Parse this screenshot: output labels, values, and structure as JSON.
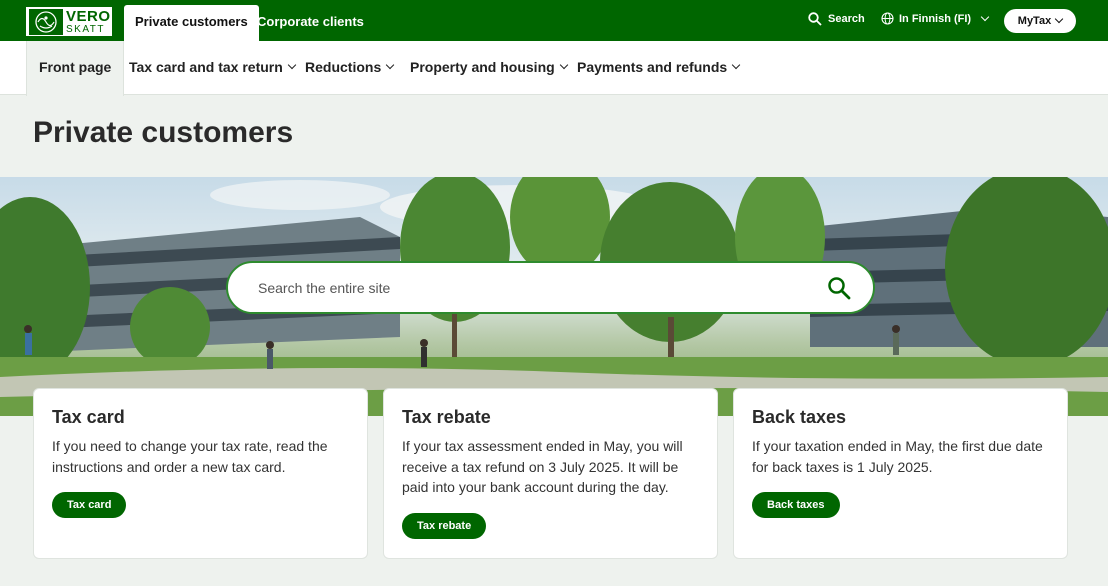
{
  "brand": {
    "line1": "VERO",
    "line2": "SKATT"
  },
  "header": {
    "tabs": [
      {
        "label": "Private customers",
        "active": true
      },
      {
        "label": "Corporate clients",
        "active": false
      }
    ],
    "search_label": "Search",
    "language_label": "In Finnish (FI)",
    "mytax_label": "MyTax"
  },
  "nav": {
    "items": [
      {
        "label": "Front page",
        "active": true
      },
      {
        "label": "Tax card and tax return",
        "has_menu": true
      },
      {
        "label": "Reductions",
        "has_menu": true
      },
      {
        "label": "Property and housing",
        "has_menu": true
      },
      {
        "label": "Payments and refunds",
        "has_menu": true
      }
    ]
  },
  "page": {
    "title": "Private customers"
  },
  "hero": {
    "search_placeholder": "Search the entire site"
  },
  "cards": [
    {
      "title": "Tax card",
      "text": "If you need to change your tax rate, read the instructions and order a new tax card.",
      "button": "Tax card"
    },
    {
      "title": "Tax rebate",
      "text": "If your tax assessment ended in May, you will receive a tax refund on 3 July 2025. It will be paid into your bank account during the day.",
      "button": "Tax rebate"
    },
    {
      "title": "Back taxes",
      "text": "If your taxation ended in May, the first due date for back taxes is 1 July 2025.",
      "button": "Back taxes"
    }
  ],
  "colors": {
    "brand_green": "#006600",
    "accent_green": "#2e8b2e",
    "page_bg": "#eef2ee"
  },
  "icons": [
    "search-icon",
    "globe-icon",
    "chevron-down-icon",
    "vero-seal-logo"
  ]
}
